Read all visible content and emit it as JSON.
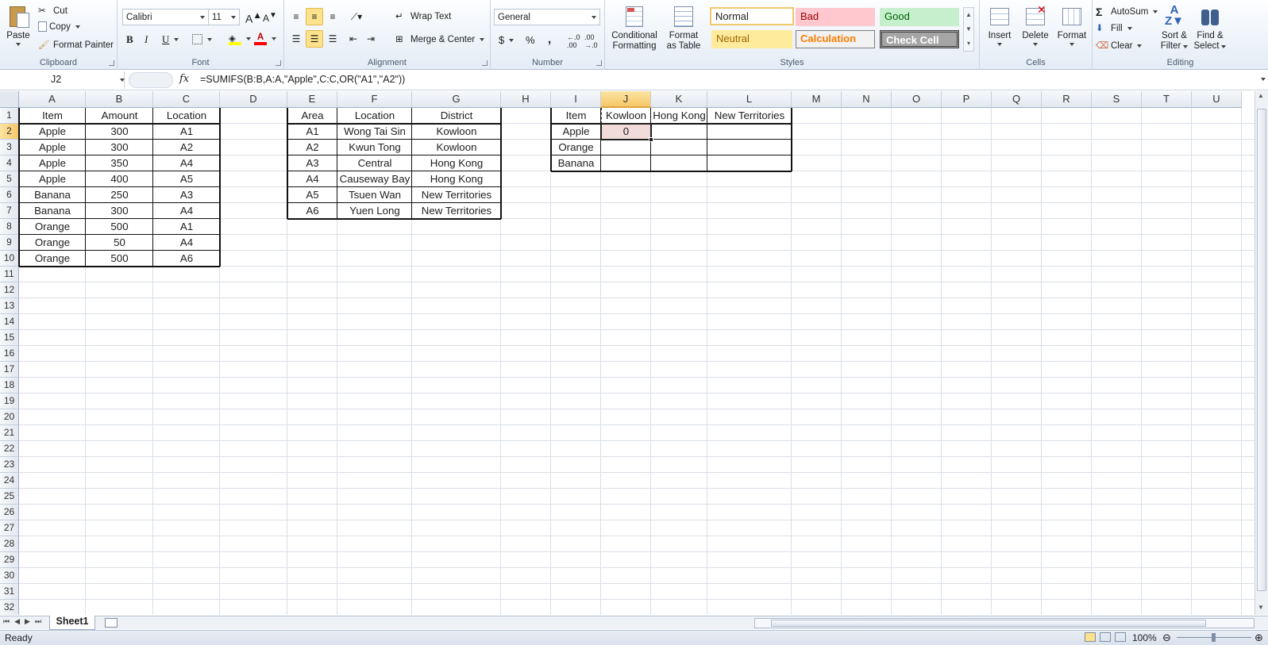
{
  "ribbon": {
    "clipboard": {
      "label": "Clipboard",
      "paste": "Paste",
      "cut": "Cut",
      "copy": "Copy",
      "format_painter": "Format Painter"
    },
    "font": {
      "label": "Font",
      "name": "Calibri",
      "size": "11",
      "bold": "B",
      "italic": "I",
      "underline": "U"
    },
    "alignment": {
      "label": "Alignment",
      "wrap_text": "Wrap Text",
      "merge_center": "Merge & Center"
    },
    "number": {
      "label": "Number",
      "format": "General",
      "currency": "$",
      "percent": "%",
      "comma": ","
    },
    "styles": {
      "label": "Styles",
      "conditional": "Conditional",
      "conditional2": "Formatting",
      "format_table": "Format",
      "format_table2": "as Table",
      "normal": "Normal",
      "bad": "Bad",
      "good": "Good",
      "neutral": "Neutral",
      "calculation": "Calculation",
      "check_cell": "Check Cell"
    },
    "cells": {
      "label": "Cells",
      "insert": "Insert",
      "delete": "Delete",
      "format": "Format"
    },
    "editing": {
      "label": "Editing",
      "autosum": "AutoSum",
      "fill": "Fill",
      "clear": "Clear",
      "sort": "Sort &",
      "sort2": "Filter",
      "find": "Find &",
      "find2": "Select"
    }
  },
  "formula_bar": {
    "name_box": "J2",
    "fx": "fx",
    "formula": "=SUMIFS(B:B,A:A,\"Apple\",C:C,OR(\"A1\",\"A2\"))"
  },
  "columns": [
    "A",
    "B",
    "C",
    "D",
    "E",
    "F",
    "G",
    "H",
    "I",
    "J",
    "K",
    "L",
    "M",
    "N",
    "O",
    "P",
    "Q",
    "R",
    "S",
    "T",
    "U"
  ],
  "rows": [
    "1",
    "2",
    "3",
    "4",
    "5",
    "6",
    "7",
    "8",
    "9",
    "10",
    "11",
    "12",
    "13",
    "14",
    "15",
    "16",
    "17",
    "18",
    "19",
    "20",
    "21",
    "22",
    "23",
    "24",
    "25",
    "26",
    "27",
    "28",
    "29",
    "30",
    "31",
    "32"
  ],
  "table1": {
    "headers": [
      "Item",
      "Amount",
      "Location"
    ],
    "rows": [
      [
        "Apple",
        "300",
        "A1"
      ],
      [
        "Apple",
        "300",
        "A2"
      ],
      [
        "Apple",
        "350",
        "A4"
      ],
      [
        "Apple",
        "400",
        "A5"
      ],
      [
        "Banana",
        "250",
        "A3"
      ],
      [
        "Banana",
        "300",
        "A4"
      ],
      [
        "Orange",
        "500",
        "A1"
      ],
      [
        "Orange",
        "50",
        "A4"
      ],
      [
        "Orange",
        "500",
        "A6"
      ]
    ]
  },
  "table2": {
    "headers": [
      "Area",
      "Location",
      "District"
    ],
    "rows": [
      [
        "A1",
        "Wong Tai Sin",
        "Kowloon"
      ],
      [
        "A2",
        "Kwun Tong",
        "Kowloon"
      ],
      [
        "A3",
        "Central",
        "Hong Kong"
      ],
      [
        "A4",
        "Causeway Bay",
        "Hong Kong"
      ],
      [
        "A5",
        "Tsuen Wan",
        "New Territories"
      ],
      [
        "A6",
        "Yuen Long",
        "New Territories"
      ]
    ]
  },
  "table3": {
    "headers": [
      "Item",
      "Kowloon",
      "Hong Kong",
      "New Territories"
    ],
    "rows": [
      [
        "Apple",
        "0",
        "",
        ""
      ],
      [
        "Orange",
        "",
        "",
        ""
      ],
      [
        "Banana",
        "",
        "",
        ""
      ]
    ]
  },
  "sheet_tab": "Sheet1",
  "status": {
    "ready": "Ready",
    "zoom": "100%"
  },
  "colors": {
    "selected_cell": "#f2dcdb",
    "accent": "#f5c86a"
  }
}
